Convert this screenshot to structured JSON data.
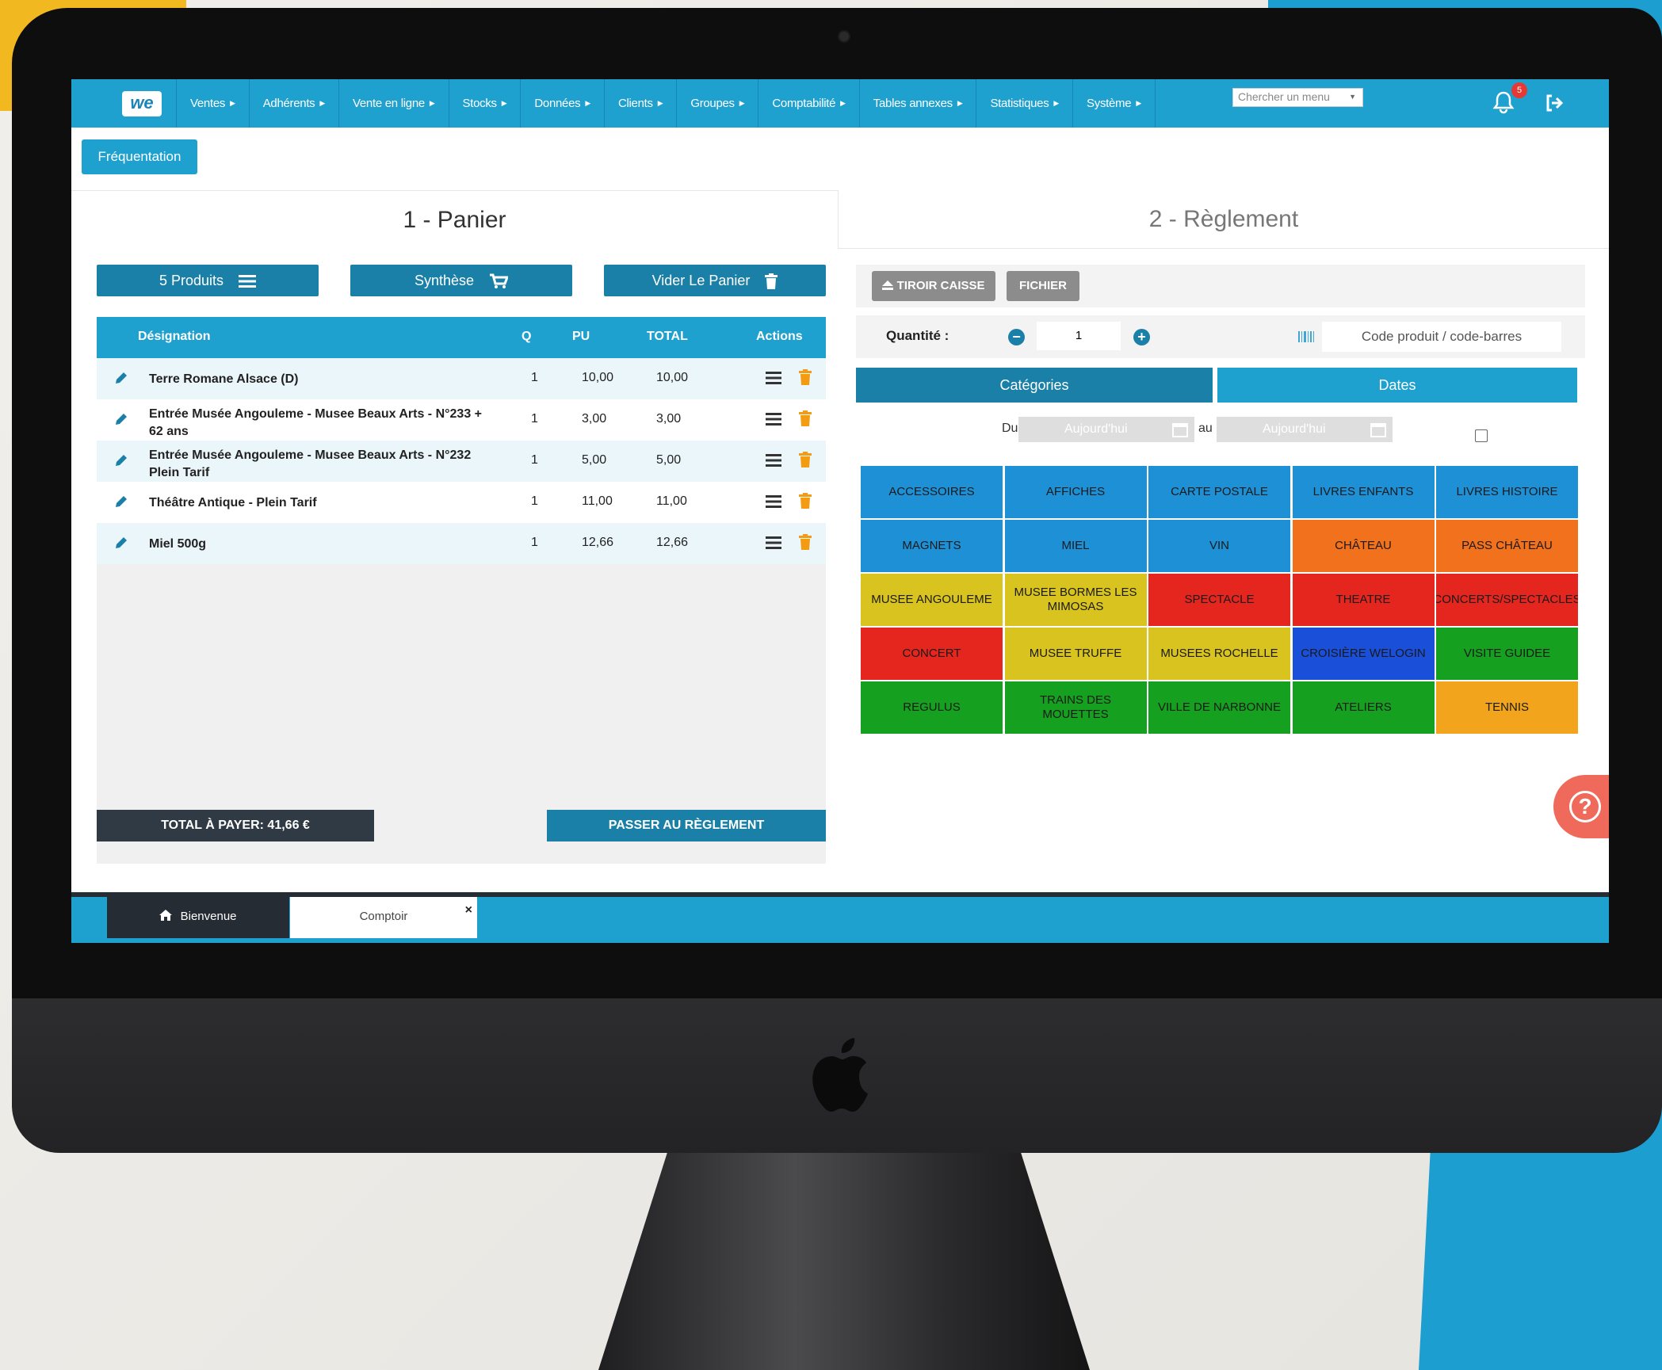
{
  "colors": {
    "primary": "#1fa1cf",
    "primary_dark": "#1a80a7",
    "dark": "#303a44",
    "gray_button": "#8c8c8c",
    "trash": "#f39c12"
  },
  "nav": {
    "logo": "we",
    "items": [
      {
        "label": "Ventes"
      },
      {
        "label": "Adhérents"
      },
      {
        "label": "Vente en ligne"
      },
      {
        "label": "Stocks"
      },
      {
        "label": "Données"
      },
      {
        "label": "Clients"
      },
      {
        "label": "Groupes"
      },
      {
        "label": "Comptabilité"
      },
      {
        "label": "Tables annexes"
      },
      {
        "label": "Statistiques"
      },
      {
        "label": "Système"
      }
    ],
    "search_placeholder": "Chercher un menu",
    "notification_count": "5",
    "icons": {
      "notifications": "bell-icon",
      "logout": "logout-icon"
    }
  },
  "page": {
    "frequentation_button": "Fréquentation",
    "step1_title": "1 - Panier",
    "step2_title": "2 - Règlement"
  },
  "cart": {
    "products_button": "5 Produits",
    "summary_button": "Synthèse",
    "empty_button": "Vider Le Panier",
    "columns": {
      "designation": "Désignation",
      "q": "Q",
      "pu": "PU",
      "total": "TOTAL",
      "actions": "Actions"
    },
    "rows": [
      {
        "designation": "Terre Romane Alsace (D)",
        "q": "1",
        "pu": "10,00",
        "total": "10,00"
      },
      {
        "designation": "Entrée Musée Angouleme - Musee Beaux Arts - N°233 + 62 ans",
        "q": "1",
        "pu": "3,00",
        "total": "3,00"
      },
      {
        "designation": "Entrée Musée Angouleme - Musee Beaux Arts - N°232 Plein Tarif",
        "q": "1",
        "pu": "5,00",
        "total": "5,00"
      },
      {
        "designation": "Théâtre Antique - Plein Tarif",
        "q": "1",
        "pu": "11,00",
        "total": "11,00"
      },
      {
        "designation": "Miel 500g",
        "q": "1",
        "pu": "12,66",
        "total": "12,66"
      }
    ],
    "total_label": "TOTAL À PAYER: 41,66 €",
    "pay_button": "PASSER AU RÈGLEMENT"
  },
  "payment": {
    "drawer_button": "TIROIR CAISSE",
    "file_button": "FICHIER",
    "quantity_label": "Quantité :",
    "quantity_value": "1",
    "code_placeholder": "Code produit / code-barres",
    "tab_categories": "Catégories",
    "tab_dates": "Dates",
    "date_from_label": "Du",
    "date_to_label": "au",
    "date_from_value": "Aujourd'hui",
    "date_to_value": "Aujourd'hui",
    "categories": [
      {
        "label": "ACCESSOIRES",
        "color": "#1e90d6"
      },
      {
        "label": "AFFICHES",
        "color": "#1e90d6"
      },
      {
        "label": "CARTE POSTALE",
        "color": "#1e90d6"
      },
      {
        "label": "LIVRES ENFANTS",
        "color": "#1e90d6"
      },
      {
        "label": "LIVRES HISTOIRE",
        "color": "#1e90d6"
      },
      {
        "label": "MAGNETS",
        "color": "#1e90d6"
      },
      {
        "label": "MIEL",
        "color": "#1e90d6"
      },
      {
        "label": "VIN",
        "color": "#1e90d6"
      },
      {
        "label": "CHÂTEAU",
        "color": "#f2711c"
      },
      {
        "label": "PASS CHÂTEAU",
        "color": "#f2711c"
      },
      {
        "label": "MUSEE ANGOULEME",
        "color": "#d9c31e"
      },
      {
        "label": "MUSEE BORMES LES MIMOSAS",
        "color": "#d9c31e"
      },
      {
        "label": "SPECTACLE",
        "color": "#e4261f"
      },
      {
        "label": "THEATRE",
        "color": "#e4261f"
      },
      {
        "label": "CONCERTS/SPECTACLES",
        "color": "#e4261f"
      },
      {
        "label": "CONCERT",
        "color": "#e4261f"
      },
      {
        "label": "MUSEE TRUFFE",
        "color": "#d9c31e"
      },
      {
        "label": "MUSEES ROCHELLE",
        "color": "#d9c31e"
      },
      {
        "label": "CROISIÈRE WELOGIN",
        "color": "#1a4fd9"
      },
      {
        "label": "VISITE GUIDEE",
        "color": "#16a01f"
      },
      {
        "label": "REGULUS",
        "color": "#16a01f"
      },
      {
        "label": "TRAINS DES MOUETTES",
        "color": "#16a01f"
      },
      {
        "label": "VILLE DE NARBONNE",
        "color": "#16a01f"
      },
      {
        "label": "ATELIERS",
        "color": "#16a01f"
      },
      {
        "label": "TENNIS",
        "color": "#f2a51c"
      }
    ]
  },
  "help": {
    "icon": "help-icon",
    "glyph": "?"
  },
  "footer": {
    "tab_home": "Bienvenue",
    "tab_counter": "Comptoir",
    "close_glyph": "×"
  }
}
